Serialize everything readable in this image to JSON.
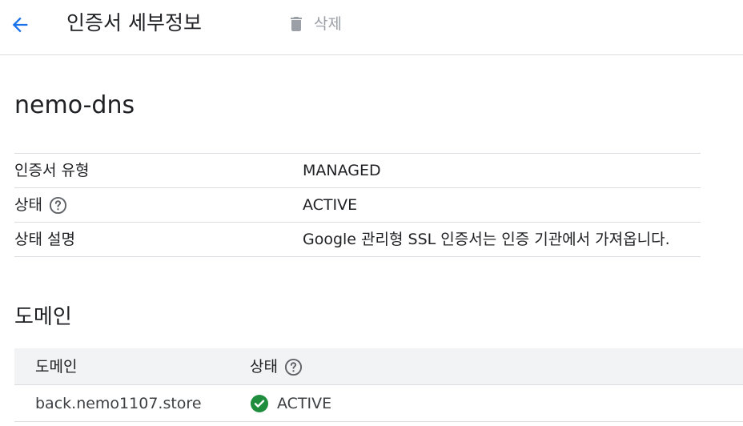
{
  "header": {
    "title": "인증서 세부정보",
    "delete_label": "삭제"
  },
  "certificate": {
    "name": "nemo-dns",
    "details": [
      {
        "label": "인증서 유형",
        "value": "MANAGED"
      },
      {
        "label": "상태",
        "value": "ACTIVE"
      },
      {
        "label": "상태 설명",
        "value": "Google 관리형 SSL 인증서는 인증 기관에서 가져옵니다."
      }
    ]
  },
  "domains": {
    "section_title": "도메인",
    "columns": [
      "도메인",
      "상태"
    ],
    "rows": [
      {
        "domain": "back.nemo1107.store",
        "status": "ACTIVE"
      }
    ]
  },
  "colors": {
    "accent": "#1a73e8",
    "success": "#1e8e3e",
    "disabled": "#9aa0a6"
  }
}
